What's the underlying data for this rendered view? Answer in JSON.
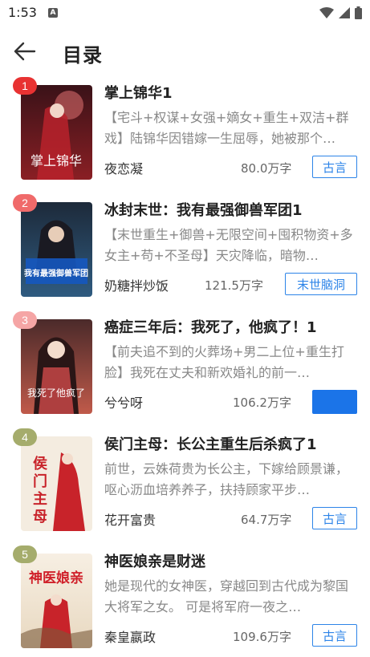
{
  "status": {
    "time": "1:53",
    "notif_letter": "A"
  },
  "header": {
    "title": "目录"
  },
  "colors": {
    "accent": "#2d84e8",
    "rank1": "#e83232",
    "rank2": "#f06a6a",
    "rank3": "#f5a5a5",
    "rank4": "#a5ac6c",
    "rank5": "#a5ac6c"
  },
  "books": [
    {
      "rank": "1",
      "title": "掌上锦华1",
      "desc": "【宅斗+权谋+女强+嫡女+重生+双洁+群戏】陆锦华因错嫁一生屈辱，她被那个…",
      "author": "夜恋凝",
      "words": "80.0万字",
      "tag": "古言",
      "cover_text": "掌上锦华"
    },
    {
      "rank": "2",
      "title": "冰封末世：我有最强御兽军团1",
      "desc": "【末世重生+御兽+无限空间+囤积物资+多女主+苟+不圣母】天灾降临，暗物…",
      "author": "奶糖拌炒饭",
      "words": "121.5万字",
      "tag": "末世脑洞",
      "cover_text": "我有最强御兽军团"
    },
    {
      "rank": "3",
      "title": "癌症三年后：我死了，他疯了！1",
      "desc": "【前夫追不到的火葬场+男二上位+重生打脸】我死在丈夫和新欢婚礼的前一…",
      "author": "兮兮呀",
      "words": "106.2万字",
      "tag": "",
      "cover_text": "我死了他疯了"
    },
    {
      "rank": "4",
      "title": "侯门主母：长公主重生后杀疯了1",
      "desc": "前世，云姝荷贵为长公主，下嫁给顾景谦，呕心沥血培养养子，扶持顾家平步…",
      "author": "花开富贵",
      "words": "64.7万字",
      "tag": "古言",
      "cover_text": "侯门主母"
    },
    {
      "rank": "5",
      "title": "神医娘亲是财迷",
      "desc": "她是现代的女神医，穿越回到古代成为黎国大将军之女。 可是将军府一夜之…",
      "author": "秦皇嬴政",
      "words": "109.6万字",
      "tag": "古言",
      "cover_text": "神医娘亲"
    }
  ]
}
